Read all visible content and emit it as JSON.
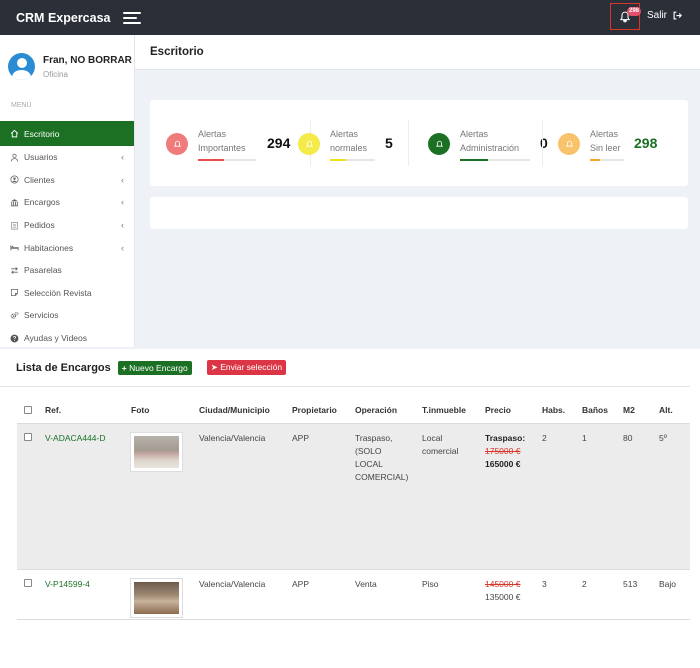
{
  "topbar": {
    "brand": "CRM Expercasa",
    "notifications": "298",
    "logout": "Salir"
  },
  "user": {
    "name": "Fran, NO BORRAR",
    "role": "Oficina"
  },
  "menu": {
    "heading": "MENÚ",
    "items": [
      {
        "label": "Escritorio",
        "icon": "home-icon",
        "chevron": false,
        "active": true
      },
      {
        "label": "Usuarios",
        "icon": "user-icon",
        "chevron": true
      },
      {
        "label": "Clientes",
        "icon": "user-circle-icon",
        "chevron": true
      },
      {
        "label": "Encargos",
        "icon": "bank-icon",
        "chevron": true
      },
      {
        "label": "Pedidos",
        "icon": "clipboard-icon",
        "chevron": true
      },
      {
        "label": "Habitaciones",
        "icon": "bed-icon",
        "chevron": true
      },
      {
        "label": "Pasarelas",
        "icon": "exchange-icon",
        "chevron": false
      },
      {
        "label": "Selección Revista",
        "icon": "note-icon",
        "chevron": false
      },
      {
        "label": "Servicios",
        "icon": "cogs-icon",
        "chevron": false
      },
      {
        "label": "Ayudas y Videos",
        "icon": "question-icon",
        "chevron": false
      }
    ]
  },
  "header": {
    "title": "Escritorio"
  },
  "alerts": [
    {
      "line1": "Alertas",
      "line2": "Importantes",
      "count": "294",
      "color": "#f07b7b",
      "bar_color": "#e84c4c",
      "fill": 0.45
    },
    {
      "line1": "Alertas",
      "line2": "normales",
      "count": "5",
      "color": "#f4ea4a",
      "bar_color": "#f0e020",
      "fill": 0.35
    },
    {
      "line1": "Alertas",
      "line2": "Administración",
      "count": "0",
      "color": "#1b7024",
      "bar_color": "#1b7024",
      "fill": 0.4
    },
    {
      "line1": "Alertas",
      "line2": "Sin leer",
      "count": "298",
      "color": "#f8c36a",
      "bar_color": "#f5a623",
      "fill": 0.3
    }
  ],
  "lista": {
    "title": "Lista de Encargos",
    "new_button": "Nuevo Encargo",
    "send_button": "Enviar selección",
    "columns": [
      "Ref.",
      "Foto",
      "Ciudad/Municipio",
      "Propietario",
      "Operación",
      "T.inmueble",
      "Precio",
      "Habs.",
      "Baños",
      "M2",
      "Alt."
    ],
    "rows": [
      {
        "ref": "V-ADACA444-D",
        "city": "Valencia/Valencia",
        "owner": "APP",
        "operation_lines": [
          "Traspaso,",
          "(SOLO",
          "LOCAL",
          "COMERCIAL)"
        ],
        "type_lines": [
          "Local",
          "comercial"
        ],
        "price_label": "Traspaso:",
        "price_old": "175000 €",
        "price_new": "165000 €",
        "habs": "2",
        "banos": "1",
        "m2": "80",
        "alt": "5º"
      },
      {
        "ref": "V-P14599-4",
        "city": "Valencia/Valencia",
        "owner": "APP",
        "operation_lines": [
          "Venta"
        ],
        "type_lines": [
          "Piso"
        ],
        "price_label": "",
        "price_old": "145000 €",
        "price_new": "135000 €",
        "habs": "3",
        "banos": "2",
        "m2": "513",
        "alt": "Bajo"
      }
    ]
  }
}
